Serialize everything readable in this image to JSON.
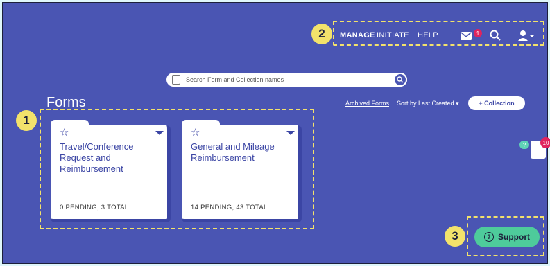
{
  "nav": {
    "manage": "MANAGE",
    "initiate": "INITIATE",
    "help": "HELP",
    "mail_badge": "1"
  },
  "search": {
    "placeholder": "Search Form and Collection names"
  },
  "page": {
    "title": "Forms",
    "archived_link": "Archived Forms",
    "sort_label": "Sort by Last Created ▾",
    "collection_button": "+ Collection"
  },
  "cards": [
    {
      "name": "Travel/Conference Request and Reimbursement",
      "count": "0 PENDING, 3 TOTAL"
    },
    {
      "name": "General and Mileage Reimbursement",
      "count": "14 PENDING, 43 TOTAL"
    }
  ],
  "support": {
    "label": "Support"
  },
  "mascot": {
    "badge": "10",
    "bubble": "?"
  },
  "markers": [
    "1",
    "2",
    "3"
  ],
  "colors": {
    "background": "#4a55b3",
    "highlight": "#f3e26b",
    "support": "#4ecb9b",
    "badge": "#e0245e"
  }
}
